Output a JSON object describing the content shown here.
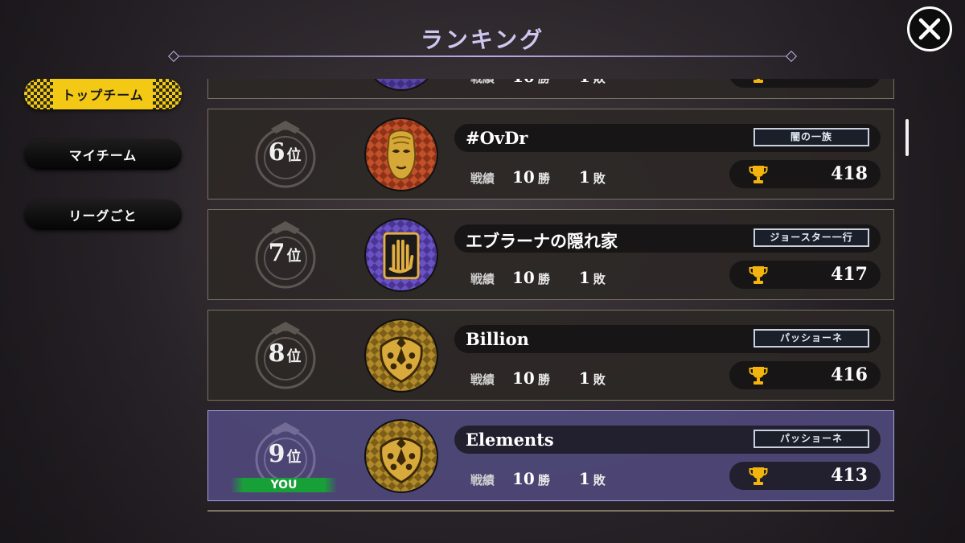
{
  "header": {
    "title": "ランキング",
    "close_icon": "close-icon"
  },
  "sidebar": {
    "items": [
      {
        "label": "トップチーム",
        "active": true
      },
      {
        "label": "マイチーム",
        "active": false
      },
      {
        "label": "リーグごと",
        "active": false
      }
    ]
  },
  "stats_label": "戦績",
  "wins_unit": "勝",
  "losses_unit": "敗",
  "rank_suffix": "位",
  "you_badge": "YOU",
  "partial_row": {
    "wins": "10",
    "losses": "1"
  },
  "rows": [
    {
      "rank": "6",
      "name": "#OvDr",
      "tag": "闇の一族",
      "wins": "10",
      "losses": "1",
      "score": "418",
      "avatar": "stone-mask-icon",
      "you": false
    },
    {
      "rank": "7",
      "name": "エブラーナの隠れ家",
      "tag": "ジョースター一行",
      "wins": "10",
      "losses": "1",
      "score": "417",
      "avatar": "hand-emblem-icon",
      "you": false
    },
    {
      "rank": "8",
      "name": "Billion",
      "tag": "パッショーネ",
      "wins": "10",
      "losses": "1",
      "score": "416",
      "avatar": "ladybug-emblem-icon",
      "you": false
    },
    {
      "rank": "9",
      "name": "Elements",
      "tag": "パッショーネ",
      "wins": "10",
      "losses": "1",
      "score": "413",
      "avatar": "ladybug-emblem-icon",
      "you": true
    }
  ],
  "colors": {
    "accent_yellow": "#f3c915",
    "you_highlight": "#4e4878",
    "you_badge_green": "#18a038",
    "title": "#cfc7f0"
  }
}
